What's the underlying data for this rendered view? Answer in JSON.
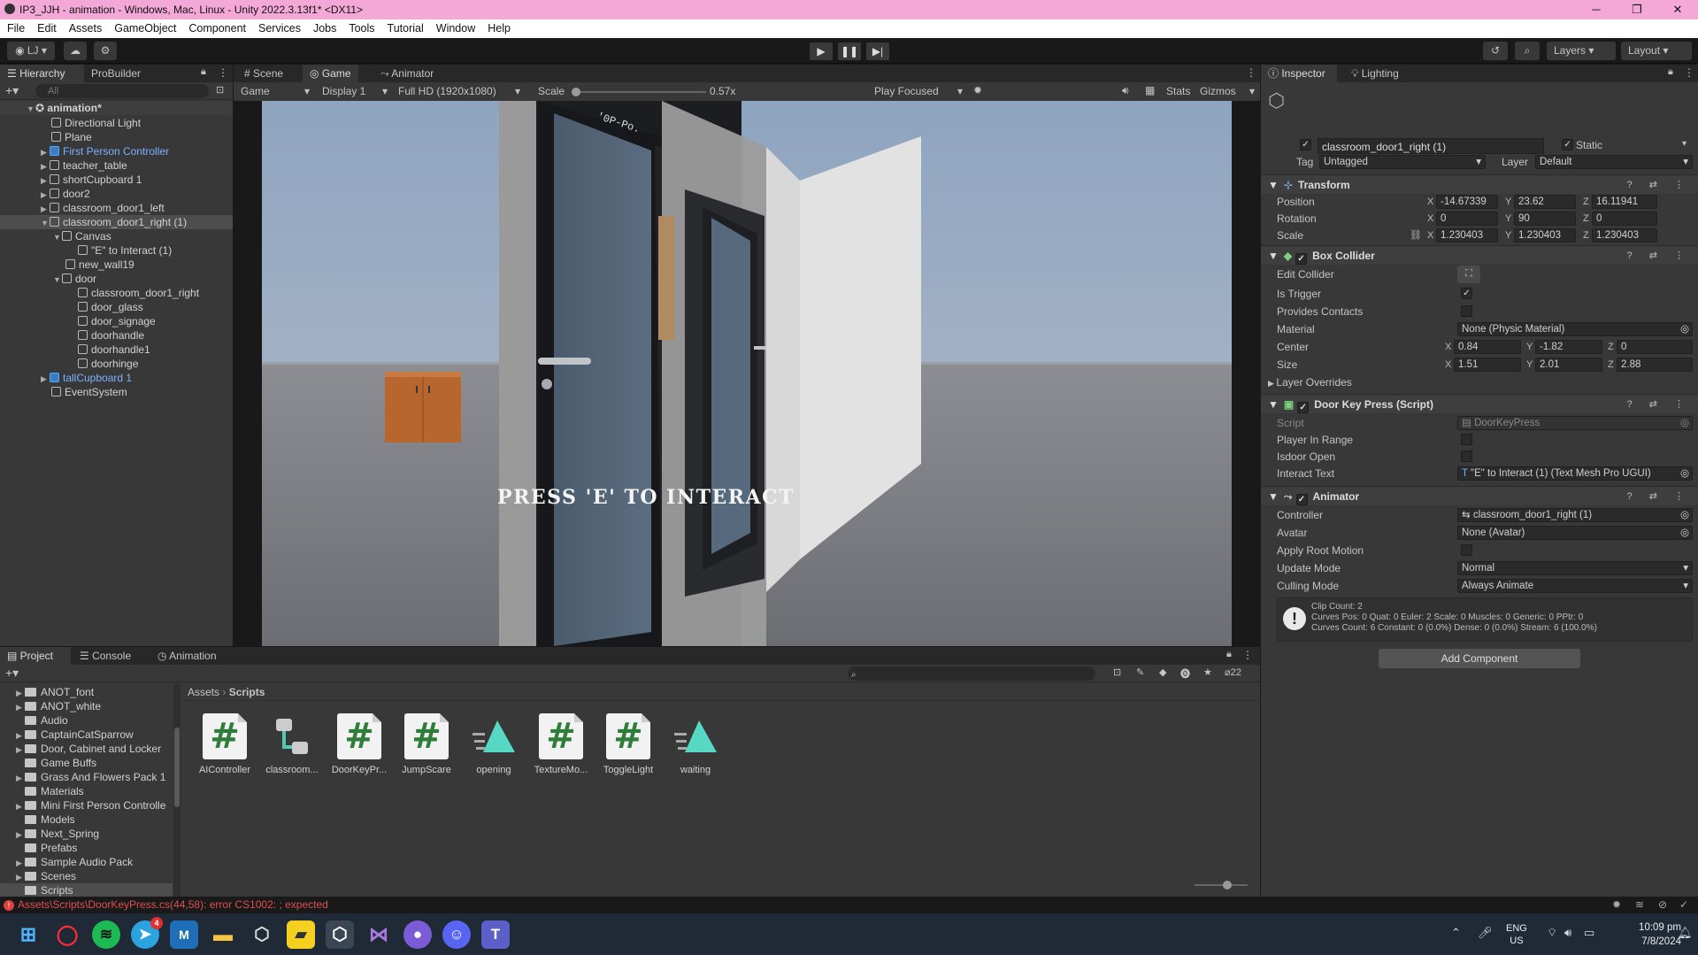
{
  "window": {
    "title": "IP3_JJH - animation - Windows, Mac, Linux - Unity 2022.3.13f1* <DX11>",
    "minimize": "─",
    "maximize": "❐",
    "close": "✕"
  },
  "menu": [
    "File",
    "Edit",
    "Assets",
    "GameObject",
    "Component",
    "Services",
    "Jobs",
    "Tools",
    "Tutorial",
    "Window",
    "Help"
  ],
  "toolbar": {
    "account": "LJ",
    "layers": "Layers",
    "layout": "Layout"
  },
  "hierarchy": {
    "tabs": [
      "Hierarchy",
      "ProBuilder"
    ],
    "search_placeholder": "All",
    "items": [
      {
        "label": "animation*",
        "depth": 0
      },
      {
        "label": "Directional Light",
        "depth": 1
      },
      {
        "label": "Plane",
        "depth": 1
      },
      {
        "label": "First Person Controller",
        "depth": 1,
        "prefab": true
      },
      {
        "label": "teacher_table",
        "depth": 1
      },
      {
        "label": "shortCupboard 1",
        "depth": 1
      },
      {
        "label": "door2",
        "depth": 1
      },
      {
        "label": "classroom_door1_left",
        "depth": 1
      },
      {
        "label": "classroom_door1_right (1)",
        "depth": 1,
        "selected": true
      },
      {
        "label": "Canvas",
        "depth": 2
      },
      {
        "label": "\"E\" to Interact (1)",
        "depth": 3
      },
      {
        "label": "new_wall19",
        "depth": 2
      },
      {
        "label": "door",
        "depth": 2
      },
      {
        "label": "classroom_door1_right",
        "depth": 3
      },
      {
        "label": "door_glass",
        "depth": 3
      },
      {
        "label": "door_signage",
        "depth": 3
      },
      {
        "label": "doorhandle",
        "depth": 3
      },
      {
        "label": "doorhandle1",
        "depth": 3
      },
      {
        "label": "doorhinge",
        "depth": 3
      },
      {
        "label": "tallCupboard 1",
        "depth": 1,
        "prefab": true
      },
      {
        "label": "EventSystem",
        "depth": 1
      }
    ]
  },
  "game": {
    "tabs": [
      "Scene",
      "Game",
      "Animator"
    ],
    "view": "Game",
    "display": "Display 1",
    "resolution": "Full HD (1920x1080)",
    "scale_label": "Scale",
    "scale_value": "0.57x",
    "play_mode": "Play Focused",
    "stats": "Stats",
    "gizmos": "Gizmos",
    "prompt": "PRESS 'E' TO INTERACT",
    "door_sign": "'0P-Po."
  },
  "inspector": {
    "tabs": [
      "Inspector",
      "Lighting"
    ],
    "name": "classroom_door1_right (1)",
    "static": "Static",
    "tag_label": "Tag",
    "tag": "Untagged",
    "layer_label": "Layer",
    "layer": "Default",
    "transform": {
      "title": "Transform",
      "position": [
        "-14.67339",
        "23.62",
        "16.11941"
      ],
      "rotation": [
        "0",
        "90",
        "0"
      ],
      "scale": [
        "1.230403",
        "1.230403",
        "1.230403"
      ],
      "labels": [
        "Position",
        "Rotation",
        "Scale"
      ]
    },
    "box_collider": {
      "title": "Box Collider",
      "edit": "Edit Collider",
      "is_trigger": "Is Trigger",
      "provides": "Provides Contacts",
      "material_label": "Material",
      "material": "None (Physic Material)",
      "center_label": "Center",
      "center": [
        "0.84",
        "-1.82",
        "0"
      ],
      "size_label": "Size",
      "size": [
        "1.51",
        "2.01",
        "2.88"
      ],
      "overrides": "Layer Overrides"
    },
    "door_script": {
      "title": "Door Key Press (Script)",
      "script_label": "Script",
      "script": "DoorKeyPress",
      "player_in_range": "Player In Range",
      "isdoor_open": "Isdoor Open",
      "interact_label": "Interact Text",
      "interact": "\"E\" to Interact (1) (Text Mesh Pro UGUI)"
    },
    "animator": {
      "title": "Animator",
      "controller_label": "Controller",
      "controller": "classroom_door1_right (1)",
      "avatar_label": "Avatar",
      "avatar": "None (Avatar)",
      "apply_root": "Apply Root Motion",
      "update_label": "Update Mode",
      "update": "Normal",
      "culling_label": "Culling Mode",
      "culling": "Always Animate",
      "info": [
        "Clip Count: 2",
        "Curves Pos: 0 Quat: 0 Euler: 2 Scale: 0 Muscles: 0 Generic: 0 PPtr: 0",
        "Curves Count: 6 Constant: 0 (0.0%) Dense: 0 (0.0%) Stream: 6 (100.0%)"
      ]
    },
    "add_component": "Add Component"
  },
  "project": {
    "tabs": [
      "Project",
      "Console",
      "Animation"
    ],
    "hidden_count": "22",
    "folders": [
      "ANOT_font",
      "ANOT_white",
      "Audio",
      "CaptainCatSparrow",
      "Door, Cabinet and Locker",
      "Game Buffs",
      "Grass And Flowers Pack 1",
      "Materials",
      "Mini First Person Controlle",
      "Models",
      "Next_Spring",
      "Prefabs",
      "Sample Audio Pack",
      "Scenes",
      "Scripts"
    ],
    "breadcrumb": [
      "Assets",
      "Scripts"
    ],
    "assets": [
      {
        "name": "AIController",
        "kind": "cs"
      },
      {
        "name": "classroom...",
        "kind": "ctrl"
      },
      {
        "name": "DoorKeyPr...",
        "kind": "cs"
      },
      {
        "name": "JumpScare",
        "kind": "cs"
      },
      {
        "name": "opening",
        "kind": "anim"
      },
      {
        "name": "TextureMo...",
        "kind": "cs"
      },
      {
        "name": "ToggleLight",
        "kind": "cs"
      },
      {
        "name": "waiting",
        "kind": "anim"
      }
    ]
  },
  "status": {
    "error": "Assets\\Scripts\\DoorKeyPress.cs(44,58): error CS1002: ; expected"
  },
  "taskbar": {
    "lang": "ENG",
    "region": "US",
    "time": "10:09 pm",
    "date": "7/8/2024",
    "telegram_badge": "4"
  }
}
